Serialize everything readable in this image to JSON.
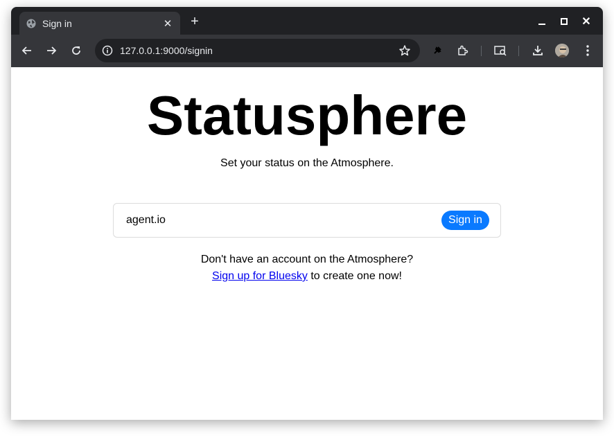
{
  "browser": {
    "tab": {
      "title": "Sign in",
      "close_glyph": "✕"
    },
    "new_tab_glyph": "+",
    "window_close_glyph": "✕",
    "url": "127.0.0.1:9000/signin",
    "icons": [
      "globe-icon",
      "back-arrow-icon",
      "forward-arrow-icon",
      "reload-icon",
      "site-info-icon",
      "bookmark-star-icon",
      "pin-icon",
      "extensions-icon",
      "media-controls-icon",
      "download-icon",
      "profile-avatar",
      "kebab-menu-icon"
    ]
  },
  "page": {
    "title": "Statusphere",
    "subtitle": "Set your status on the Atmosphere.",
    "form": {
      "handle_value": "agent.io",
      "signin_label": "Sign in"
    },
    "signup": {
      "question": "Don't have an account on the Atmosphere?",
      "link_text": "Sign up for Bluesky",
      "suffix": " to create one now!"
    }
  },
  "colors": {
    "accent": "#0a7aff",
    "link": "#0000ee",
    "chrome_dark": "#202124",
    "chrome_toolbar": "#35363a"
  }
}
